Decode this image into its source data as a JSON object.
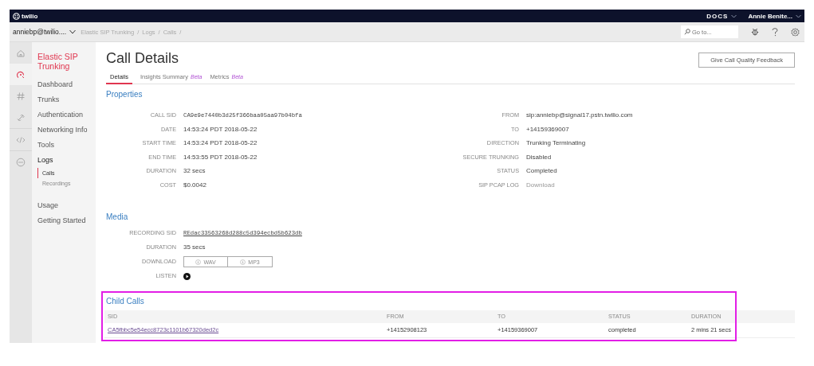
{
  "topbar": {
    "logo": "twilio",
    "docs": "DOCS",
    "user": "Annie Benite..."
  },
  "subbar": {
    "account": "anniebp@twilio....",
    "breadcrumbs": [
      "Elastic SIP Trunking",
      "Logs",
      "Calls"
    ],
    "separator": "/",
    "search": {
      "placeholder": "Go to..."
    }
  },
  "rail": [
    {
      "kind": "home",
      "selected": false
    },
    {
      "kind": "sip",
      "selected": true
    },
    {
      "kind": "hash",
      "selected": false
    },
    {
      "kind": "link",
      "selected": false
    },
    {
      "kind": "code",
      "selected": false
    },
    {
      "kind": "more",
      "selected": false
    }
  ],
  "nav": {
    "title": "Elastic SIP Trunking",
    "items": [
      {
        "label": "Dashboard",
        "selected": false
      },
      {
        "label": "Trunks",
        "selected": false
      },
      {
        "label": "Authentication",
        "selected": false
      },
      {
        "label": "Networking Info",
        "selected": false
      },
      {
        "label": "Tools",
        "selected": false
      },
      {
        "label": "Logs",
        "selected": false,
        "expanded": true,
        "children": [
          {
            "label": "Calls",
            "selected": true
          },
          {
            "label": "Recordings",
            "selected": false
          }
        ]
      },
      {
        "label": "Usage",
        "selected": false
      },
      {
        "label": "Getting Started",
        "selected": false
      }
    ]
  },
  "page": {
    "title": "Call Details",
    "feedback_button": "Give Call Quality Feedback",
    "tabs": [
      {
        "label": "Details",
        "selected": true
      },
      {
        "label": "Insights Summary",
        "badge": "Beta",
        "selected": false
      },
      {
        "label": "Metrics",
        "badge": "Beta",
        "selected": false
      }
    ]
  },
  "properties": {
    "title": "Properties",
    "left": [
      {
        "label": "CALL SID",
        "value": "CA9e9e7440b3d25f366baa05aa97b04bfa",
        "kind": "mono"
      },
      {
        "label": "DATE",
        "value": "14:53:24 PDT 2018-05-22",
        "kind": "text"
      },
      {
        "label": "START TIME",
        "value": "14:53:24 PDT 2018-05-22",
        "kind": "text"
      },
      {
        "label": "END TIME",
        "value": "14:53:55 PDT 2018-05-22",
        "kind": "text"
      },
      {
        "label": "DURATION",
        "value": "32 secs",
        "kind": "text"
      },
      {
        "label": "COST",
        "value": "$0.0042",
        "kind": "text"
      }
    ],
    "right": [
      {
        "label": "FROM",
        "value": "sip:anniebp@signal17.pstn.twilio.com",
        "kind": "text"
      },
      {
        "label": "TO",
        "value": "+14159369007",
        "kind": "text"
      },
      {
        "label": "DIRECTION",
        "value": "Trunking Terminating",
        "kind": "text"
      },
      {
        "label": "SECURE TRUNKING",
        "value": "Disabled",
        "kind": "text"
      },
      {
        "label": "STATUS",
        "value": "Completed",
        "kind": "text"
      },
      {
        "label": "SIP PCAP LOG",
        "value": "Download",
        "kind": "link"
      }
    ]
  },
  "media": {
    "title": "Media",
    "rows": [
      {
        "label": "RECORDING SID",
        "value": "REdac33563268d288c5d394ecbd5b623db",
        "kind": "sid"
      },
      {
        "label": "DURATION",
        "value": "35 secs",
        "kind": "text"
      },
      {
        "label": "DOWNLOAD",
        "kind": "buttons",
        "buttons": [
          "WAV",
          "MP3"
        ]
      },
      {
        "label": "LISTEN",
        "kind": "play"
      }
    ]
  },
  "child_calls": {
    "title": "Child Calls",
    "highlighted": true,
    "columns": [
      "SID",
      "FROM",
      "TO",
      "STATUS",
      "DURATION"
    ],
    "rows": [
      [
        "CA5fbbc5e54ecc8723c1101b67320ded2c",
        "+14152908123",
        "+14159369007",
        "completed",
        "2 mins 21 secs"
      ]
    ]
  }
}
